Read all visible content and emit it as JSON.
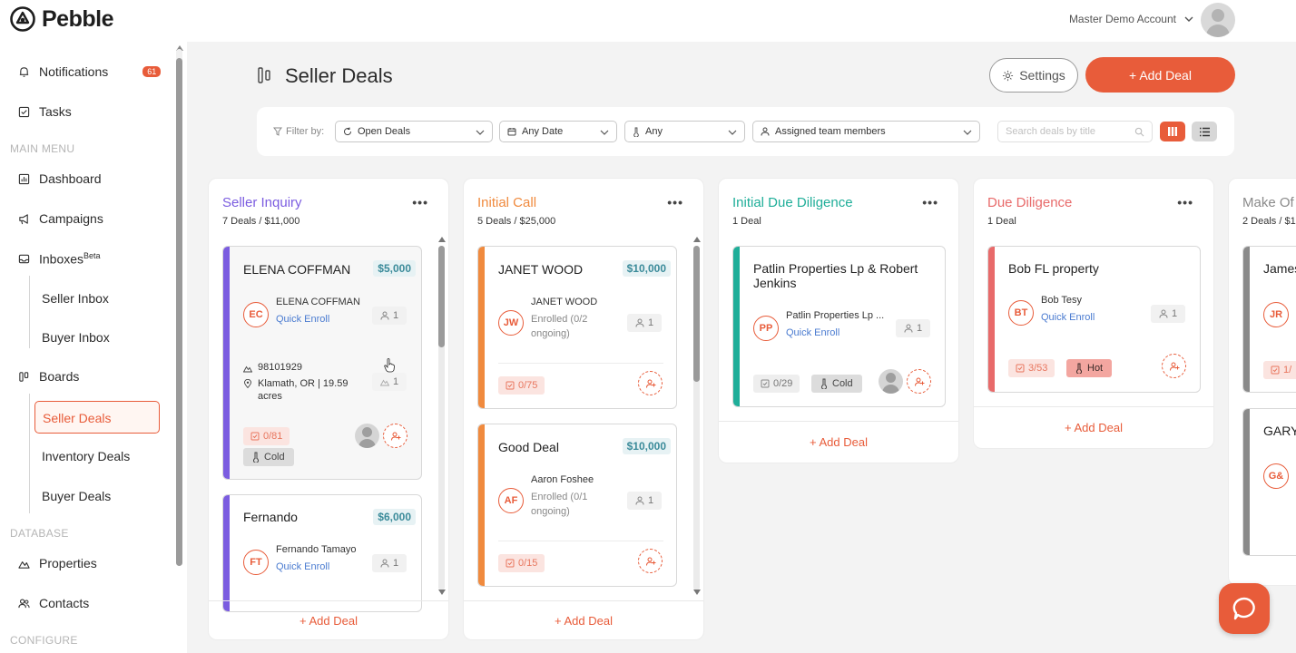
{
  "app": {
    "name": "Pebble"
  },
  "account": {
    "name": "Master Demo Account"
  },
  "sidebar": {
    "notifications": {
      "label": "Notifications",
      "badge": "61"
    },
    "tasks": "Tasks",
    "main_menu_label": "MAIN MENU",
    "dashboard": "Dashboard",
    "campaigns": "Campaigns",
    "inboxes": {
      "label": "Inboxes",
      "sup": "Beta"
    },
    "seller_inbox": "Seller Inbox",
    "buyer_inbox": "Buyer Inbox",
    "boards": "Boards",
    "seller_deals": "Seller Deals",
    "inventory_deals": "Inventory Deals",
    "buyer_deals": "Buyer Deals",
    "database_label": "DATABASE",
    "properties": "Properties",
    "contacts": "Contacts",
    "configure_label": "CONFIGURE"
  },
  "header": {
    "title": "Seller Deals",
    "settings_label": "Settings",
    "add_deal_label": "+ Add Deal"
  },
  "filters": {
    "label": "Filter by:",
    "status": "Open Deals",
    "date": "Any Date",
    "temperature": "Any",
    "members": "Assigned team members",
    "search_placeholder": "Search deals by title"
  },
  "colors": {
    "accent": "#e85c3a",
    "seller_inquiry": "#7b5ce0",
    "initial_call": "#f08a3e",
    "initial_due_diligence": "#1fae99",
    "due_diligence": "#e86a6a",
    "make_offer": "#8a8a8a"
  },
  "columns": [
    {
      "title": "Seller Inquiry",
      "summary": "7 Deals / $11,000",
      "add_label": "+ Add Deal",
      "cards": [
        {
          "title": "ELENA COFFMAN",
          "price": "$5,000",
          "initials": "EC",
          "contact": "ELENA COFFMAN",
          "contact_sub": "Quick Enroll",
          "members": "1",
          "zip": "98101929",
          "location": "Klamath, OR | 19.59 acres",
          "location_members": "1",
          "tasks": "0/81",
          "temperature": "Cold"
        },
        {
          "title": "Fernando",
          "price": "$6,000",
          "initials": "FT",
          "contact": "Fernando Tamayo",
          "contact_sub": "Quick Enroll",
          "members": "1"
        }
      ]
    },
    {
      "title": "Initial Call",
      "summary": "5 Deals / $25,000",
      "add_label": "+ Add Deal",
      "cards": [
        {
          "title": "JANET WOOD",
          "price": "$10,000",
          "initials": "JW",
          "contact": "JANET WOOD",
          "contact_sub": "Enrolled (0/2 ongoing)",
          "members": "1",
          "tasks": "0/75"
        },
        {
          "title": "Good Deal",
          "price": "$10,000",
          "initials": "AF",
          "contact": "Aaron Foshee",
          "contact_sub": "Enrolled (0/1 ongoing)",
          "members": "1",
          "tasks": "0/15"
        }
      ]
    },
    {
      "title": "Initial Due Diligence",
      "summary": "1 Deal",
      "add_label": "+ Add Deal",
      "cards": [
        {
          "title": "Patlin Properties Lp & Robert Jenkins",
          "initials": "PP",
          "contact": "Patlin Properties Lp ...",
          "contact_sub": "Quick Enroll",
          "members": "1",
          "tasks": "0/29",
          "temperature": "Cold"
        }
      ]
    },
    {
      "title": "Due Diligence",
      "summary": "1 Deal",
      "add_label": "+ Add Deal",
      "cards": [
        {
          "title": "Bob FL property",
          "initials": "BT",
          "contact": "Bob Tesy",
          "contact_sub": "Quick Enroll",
          "members": "1",
          "tasks": "3/53",
          "temperature": "Hot"
        }
      ]
    },
    {
      "title": "Make Of",
      "summary": "2 Deals / $1",
      "cards": [
        {
          "title": "James",
          "initials": "JR",
          "tasks": "1/"
        },
        {
          "title": "GARY",
          "initials": "G&"
        }
      ]
    }
  ]
}
